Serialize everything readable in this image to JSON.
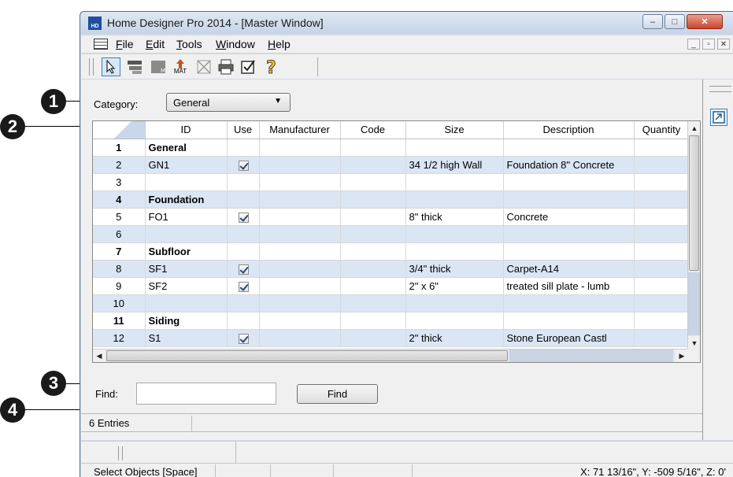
{
  "window": {
    "title": "Home Designer Pro 2014 - [Master Window]",
    "app_icon_text": "HD",
    "controls": {
      "minimize": "–",
      "maximize": "□",
      "close": "✕"
    }
  },
  "menubar": {
    "items": [
      {
        "label": "File",
        "mnemonic": "F"
      },
      {
        "label": "Edit",
        "mnemonic": "E"
      },
      {
        "label": "Tools",
        "mnemonic": "T"
      },
      {
        "label": "Window",
        "mnemonic": "W"
      },
      {
        "label": "Help",
        "mnemonic": "H"
      }
    ],
    "mdi_controls": {
      "minimize": "_",
      "restore": "▫",
      "close": "✕"
    }
  },
  "toolbar": {
    "mat_label": "MAT"
  },
  "category": {
    "label": "Category:",
    "selected": "General"
  },
  "table": {
    "headers": [
      "",
      "ID",
      "Use",
      "Manufacturer",
      "Code",
      "Size",
      "Description",
      "Quantity"
    ],
    "rows": [
      {
        "num": "1",
        "id": "General",
        "use": false,
        "manufacturer": "",
        "code": "",
        "size": "",
        "description": "",
        "quantity": "",
        "bold": true
      },
      {
        "num": "2",
        "id": "GN1",
        "use": true,
        "manufacturer": "",
        "code": "",
        "size": "34 1/2 high Wall",
        "description": "Foundation 8\" Concrete",
        "quantity": "",
        "bold": false
      },
      {
        "num": "3",
        "id": "",
        "use": false,
        "manufacturer": "",
        "code": "",
        "size": "",
        "description": "",
        "quantity": "",
        "bold": false
      },
      {
        "num": "4",
        "id": "Foundation",
        "use": false,
        "manufacturer": "",
        "code": "",
        "size": "",
        "description": "",
        "quantity": "",
        "bold": true
      },
      {
        "num": "5",
        "id": "FO1",
        "use": true,
        "manufacturer": "",
        "code": "",
        "size": "8\" thick",
        "description": "Concrete",
        "quantity": "",
        "bold": false
      },
      {
        "num": "6",
        "id": "",
        "use": false,
        "manufacturer": "",
        "code": "",
        "size": "",
        "description": "",
        "quantity": "",
        "bold": false
      },
      {
        "num": "7",
        "id": "Subfloor",
        "use": false,
        "manufacturer": "",
        "code": "",
        "size": "",
        "description": "",
        "quantity": "",
        "bold": true
      },
      {
        "num": "8",
        "id": "SF1",
        "use": true,
        "manufacturer": "",
        "code": "",
        "size": "3/4\" thick",
        "description": "Carpet-A14",
        "quantity": "",
        "bold": false
      },
      {
        "num": "9",
        "id": "SF2",
        "use": true,
        "manufacturer": "",
        "code": "",
        "size": "2\" x 6\"",
        "description": "treated sill plate - lumb",
        "quantity": "",
        "bold": false
      },
      {
        "num": "10",
        "id": "",
        "use": false,
        "manufacturer": "",
        "code": "",
        "size": "",
        "description": "",
        "quantity": "",
        "bold": false
      },
      {
        "num": "11",
        "id": "Siding",
        "use": false,
        "manufacturer": "",
        "code": "",
        "size": "",
        "description": "",
        "quantity": "",
        "bold": true
      },
      {
        "num": "12",
        "id": "S1",
        "use": true,
        "manufacturer": "",
        "code": "",
        "size": "2\" thick",
        "description": "Stone  European Castl",
        "quantity": "",
        "bold": false
      }
    ]
  },
  "find": {
    "label": "Find:",
    "value": "",
    "button_label": "Find"
  },
  "entries": {
    "text": "6 Entries"
  },
  "statusbar": {
    "left": "Select Objects [Space]",
    "right": "X: 71 13/16\", Y: -509 5/16\", Z: 0'"
  },
  "callouts": [
    "1",
    "2",
    "3",
    "4"
  ]
}
